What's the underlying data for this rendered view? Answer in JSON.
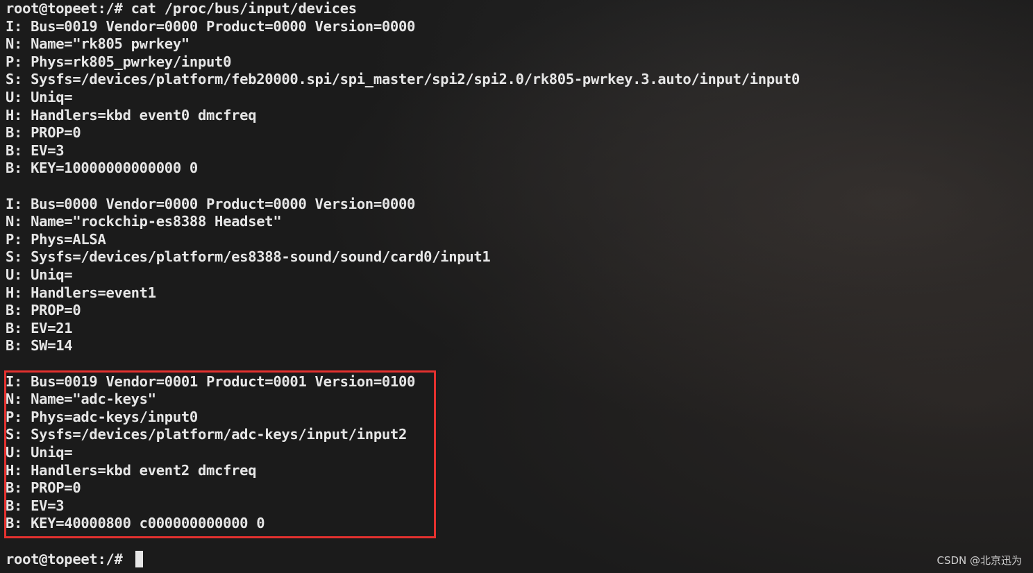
{
  "terminal": {
    "lines": [
      "root@topeet:/# cat /proc/bus/input/devices",
      "I: Bus=0019 Vendor=0000 Product=0000 Version=0000",
      "N: Name=\"rk805 pwrkey\"",
      "P: Phys=rk805_pwrkey/input0",
      "S: Sysfs=/devices/platform/feb20000.spi/spi_master/spi2/spi2.0/rk805-pwrkey.3.auto/input/input0",
      "U: Uniq=",
      "H: Handlers=kbd event0 dmcfreq",
      "B: PROP=0",
      "B: EV=3",
      "B: KEY=10000000000000 0",
      "",
      "I: Bus=0000 Vendor=0000 Product=0000 Version=0000",
      "N: Name=\"rockchip-es8388 Headset\"",
      "P: Phys=ALSA",
      "S: Sysfs=/devices/platform/es8388-sound/sound/card0/input1",
      "U: Uniq=",
      "H: Handlers=event1",
      "B: PROP=0",
      "B: EV=21",
      "B: SW=14",
      "",
      "I: Bus=0019 Vendor=0001 Product=0001 Version=0100",
      "N: Name=\"adc-keys\"",
      "P: Phys=adc-keys/input0",
      "S: Sysfs=/devices/platform/adc-keys/input/input2",
      "U: Uniq=",
      "H: Handlers=kbd event2 dmcfreq",
      "B: PROP=0",
      "B: EV=3",
      "B: KEY=40000800 c000000000000 0",
      "",
      "root@topeet:/# "
    ]
  },
  "watermark": "CSDN @北京迅为",
  "colors": {
    "background": "#1b1b1b",
    "text": "#e6e6e6",
    "highlight": "#e4312f"
  }
}
